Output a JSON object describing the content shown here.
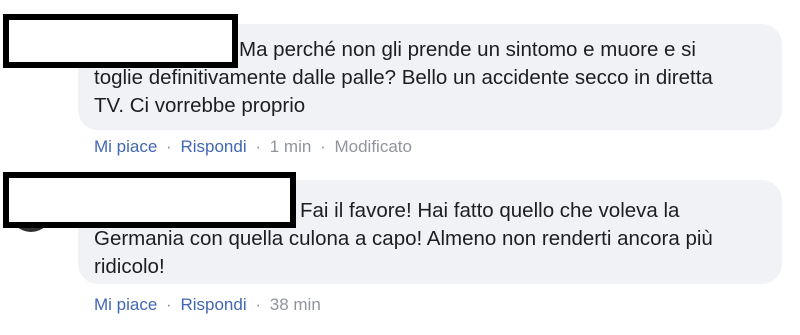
{
  "comments": [
    {
      "lines": [
        "Ma perché non gli prende un sintomo e muore e si",
        "toglie definitivamente dalle palle? Bello un accidente secco in diretta",
        "TV. Ci vorrebbe proprio"
      ],
      "like_label": "Mi piace",
      "reply_label": "Rispondi",
      "time": "1 min",
      "edited": "Modificato"
    },
    {
      "lines": [
        "Fai il favore! Hai fatto quello che voleva la",
        "Germania con quella culona a capo! Almeno non renderti ancora più",
        "ridicolo!"
      ],
      "like_label": "Mi piace",
      "reply_label": "Rispondi",
      "time": "38 min"
    }
  ],
  "separator": "·",
  "colors": {
    "bubble": "#f0f2f5",
    "link": "#4267b2",
    "meta": "#90949c",
    "text": "#1c1e21"
  }
}
